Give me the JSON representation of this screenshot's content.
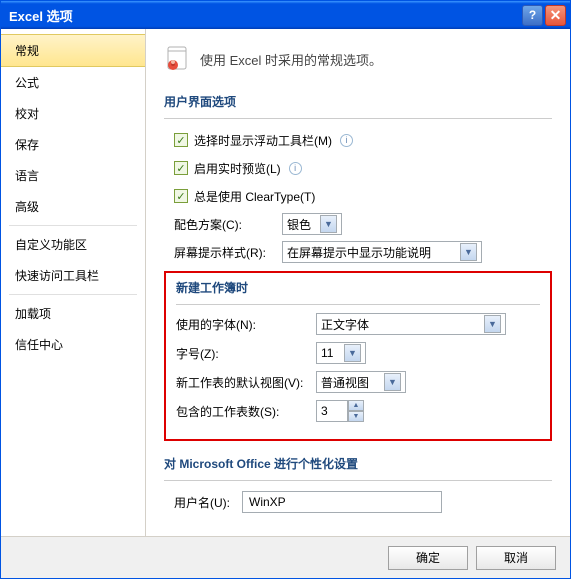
{
  "title": "Excel 选项",
  "hero": "使用 Excel 时采用的常规选项。",
  "sidebar": [
    "常规",
    "公式",
    "校对",
    "保存",
    "语言",
    "高级",
    "-",
    "自定义功能区",
    "快速访问工具栏",
    "-",
    "加载项",
    "信任中心"
  ],
  "sect_ui": "用户界面选项",
  "opt_floating": "选择时显示浮动工具栏(M)",
  "opt_preview": "启用实时预览(L)",
  "opt_cleartype": "总是使用 ClearType(T)",
  "lbl_color": "配色方案(C):",
  "val_color": "银色",
  "lbl_tip": "屏幕提示样式(R):",
  "val_tip": "在屏幕提示中显示功能说明",
  "sect_new": "新建工作簿时",
  "lbl_font": "使用的字体(N):",
  "val_font": "正文字体",
  "lbl_size": "字号(Z):",
  "val_size": "11",
  "lbl_view": "新工作表的默认视图(V):",
  "val_view": "普通视图",
  "lbl_sheets": "包含的工作表数(S):",
  "val_sheets": "3",
  "sect_personal": "对 Microsoft Office 进行个性化设置",
  "lbl_user": "用户名(U):",
  "val_user": "WinXP",
  "btn_ok": "确定",
  "btn_cancel": "取消"
}
